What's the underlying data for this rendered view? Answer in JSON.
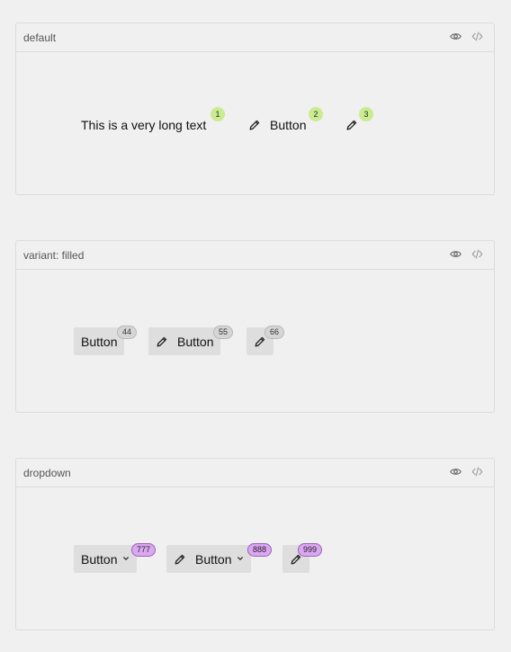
{
  "sections": [
    {
      "title": "default",
      "items": [
        {
          "label": "This is a very long text",
          "badge": "1"
        },
        {
          "label": "Button",
          "badge": "2"
        },
        {
          "label": "",
          "badge": "3"
        }
      ]
    },
    {
      "title": "variant: filled",
      "items": [
        {
          "label": "Button",
          "badge": "44"
        },
        {
          "label": "Button",
          "badge": "55"
        },
        {
          "label": "",
          "badge": "66"
        }
      ]
    },
    {
      "title": "dropdown",
      "items": [
        {
          "label": "Button",
          "badge": "777"
        },
        {
          "label": "Button",
          "badge": "888"
        },
        {
          "label": "",
          "badge": "999"
        }
      ]
    }
  ],
  "icons": {
    "view": "eye-icon",
    "code": "code-icon",
    "edit": "pencil-icon",
    "dropdown": "chevron-down-icon"
  },
  "colors": {
    "badge_default": "#c9ec8f",
    "badge_filled": "#d5d5d5",
    "badge_dropdown": "#d9a8ee"
  }
}
